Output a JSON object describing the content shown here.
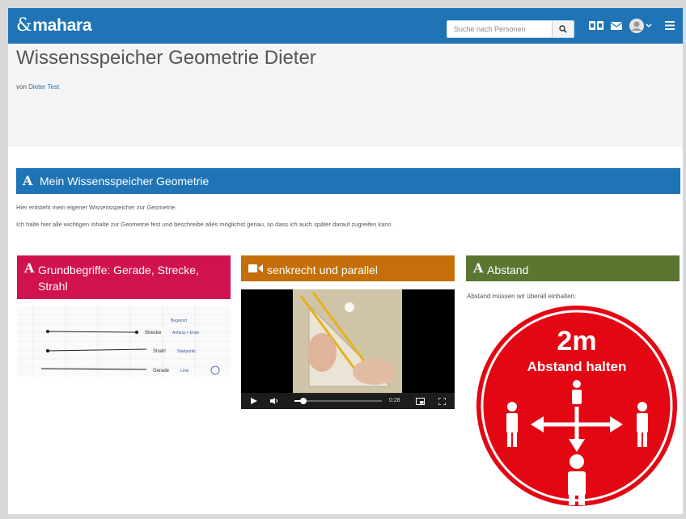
{
  "app": {
    "logo": "mahara"
  },
  "search": {
    "placeholder": "Suche nach Personen"
  },
  "page": {
    "title": "Wissensspeicher Geometrie Dieter",
    "by_prefix": "von",
    "author": "Dieter Test"
  },
  "section": {
    "title": "Mein Wissensspeicher Geometrie",
    "line1": "Hier entsteht mein eigener Wissensspeicher zur Geometrie.",
    "line2": "Ich halte hier alle wichtigen Inhalte zur Geometrie fest und beschreibe alles möglichst genau, so dass ich auch später darauf zugreifen kann."
  },
  "blocks": {
    "grund": {
      "title": "Grundbegriffe: Gerade, Strecke, Strahl",
      "color": "#d0124f"
    },
    "video": {
      "title": "senkrecht und parallel",
      "color": "#c46f0a",
      "time": "0:28",
      "progress": 0.1
    },
    "abstand": {
      "title": "Abstand",
      "color": "#5b7630",
      "text": "Abstand müssen wir überall einhalten:"
    }
  },
  "sketch": {
    "labels": [
      "Strecke",
      "Strahl",
      "Gerade"
    ],
    "notes": [
      "Begrenzt",
      "Anfang + Ende",
      "Startpunkt",
      "Linie"
    ]
  },
  "sign": {
    "big": "2m",
    "sub": "Abstand halten",
    "color": "#e30613"
  },
  "colors": {
    "brand": "#1f74b6"
  }
}
